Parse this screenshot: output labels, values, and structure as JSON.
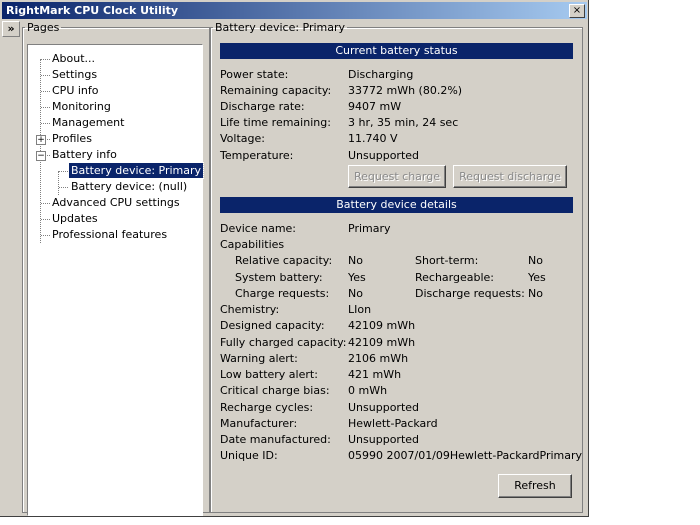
{
  "window": {
    "title": "RightMark CPU Clock Utility",
    "close_glyph": "×",
    "toggle_glyph": "»"
  },
  "pages": {
    "legend": "Pages",
    "items": [
      {
        "label": "About..."
      },
      {
        "label": "Settings"
      },
      {
        "label": "CPU info"
      },
      {
        "label": "Monitoring"
      },
      {
        "label": "Management"
      },
      {
        "label": "Profiles",
        "expander": "+"
      },
      {
        "label": "Battery info",
        "expander": "−"
      },
      {
        "label": "Battery device: Primary",
        "selected": true
      },
      {
        "label": "Battery device: (null)"
      },
      {
        "label": "Advanced CPU settings"
      },
      {
        "label": "Updates"
      },
      {
        "label": "Professional features"
      }
    ]
  },
  "detail": {
    "legend": "Battery device: Primary",
    "status_header": "Current battery status",
    "status": {
      "power_state": {
        "label": "Power state:",
        "value": "Discharging"
      },
      "remaining_capacity": {
        "label": "Remaining capacity:",
        "value": "33772 mWh (80.2%)"
      },
      "discharge_rate": {
        "label": "Discharge rate:",
        "value": "9407 mW"
      },
      "life_time": {
        "label": "Life time remaining:",
        "value": "3 hr, 35 min, 24 sec"
      },
      "voltage": {
        "label": "Voltage:",
        "value": "11.740 V"
      },
      "temperature": {
        "label": "Temperature:",
        "value": "Unsupported"
      }
    },
    "request_charge": "Request charge",
    "request_discharge": "Request discharge",
    "details_header": "Battery device details",
    "device_name": {
      "label": "Device name:",
      "value": "Primary"
    },
    "capabilities_label": "Capabilities",
    "capabilities": {
      "relative_capacity": {
        "label": "Relative capacity:",
        "value": "No"
      },
      "short_term": {
        "label": "Short-term:",
        "value": "No"
      },
      "system_battery": {
        "label": "System battery:",
        "value": "Yes"
      },
      "rechargeable": {
        "label": "Rechargeable:",
        "value": "Yes"
      },
      "charge_requests": {
        "label": "Charge requests:",
        "value": "No"
      },
      "discharge_requests": {
        "label": "Discharge requests:",
        "value": "No"
      }
    },
    "info": {
      "chemistry": {
        "label": "Chemistry:",
        "value": "LIon"
      },
      "designed_capacity": {
        "label": "Designed capacity:",
        "value": "42109 mWh"
      },
      "fully_charged": {
        "label": "Fully charged capacity:",
        "value": "42109 mWh"
      },
      "warning_alert": {
        "label": "Warning alert:",
        "value": "2106 mWh"
      },
      "low_battery_alert": {
        "label": "Low battery alert:",
        "value": "421 mWh"
      },
      "critical_bias": {
        "label": "Critical charge bias:",
        "value": "0 mWh"
      },
      "recharge_cycles": {
        "label": "Recharge cycles:",
        "value": "Unsupported"
      },
      "manufacturer": {
        "label": "Manufacturer:",
        "value": "Hewlett-Packard"
      },
      "date_manufactured": {
        "label": "Date manufactured:",
        "value": "Unsupported"
      },
      "unique_id": {
        "label": "Unique ID:",
        "value": "05990 2007/01/09Hewlett-PackardPrimary"
      }
    },
    "refresh": "Refresh"
  }
}
